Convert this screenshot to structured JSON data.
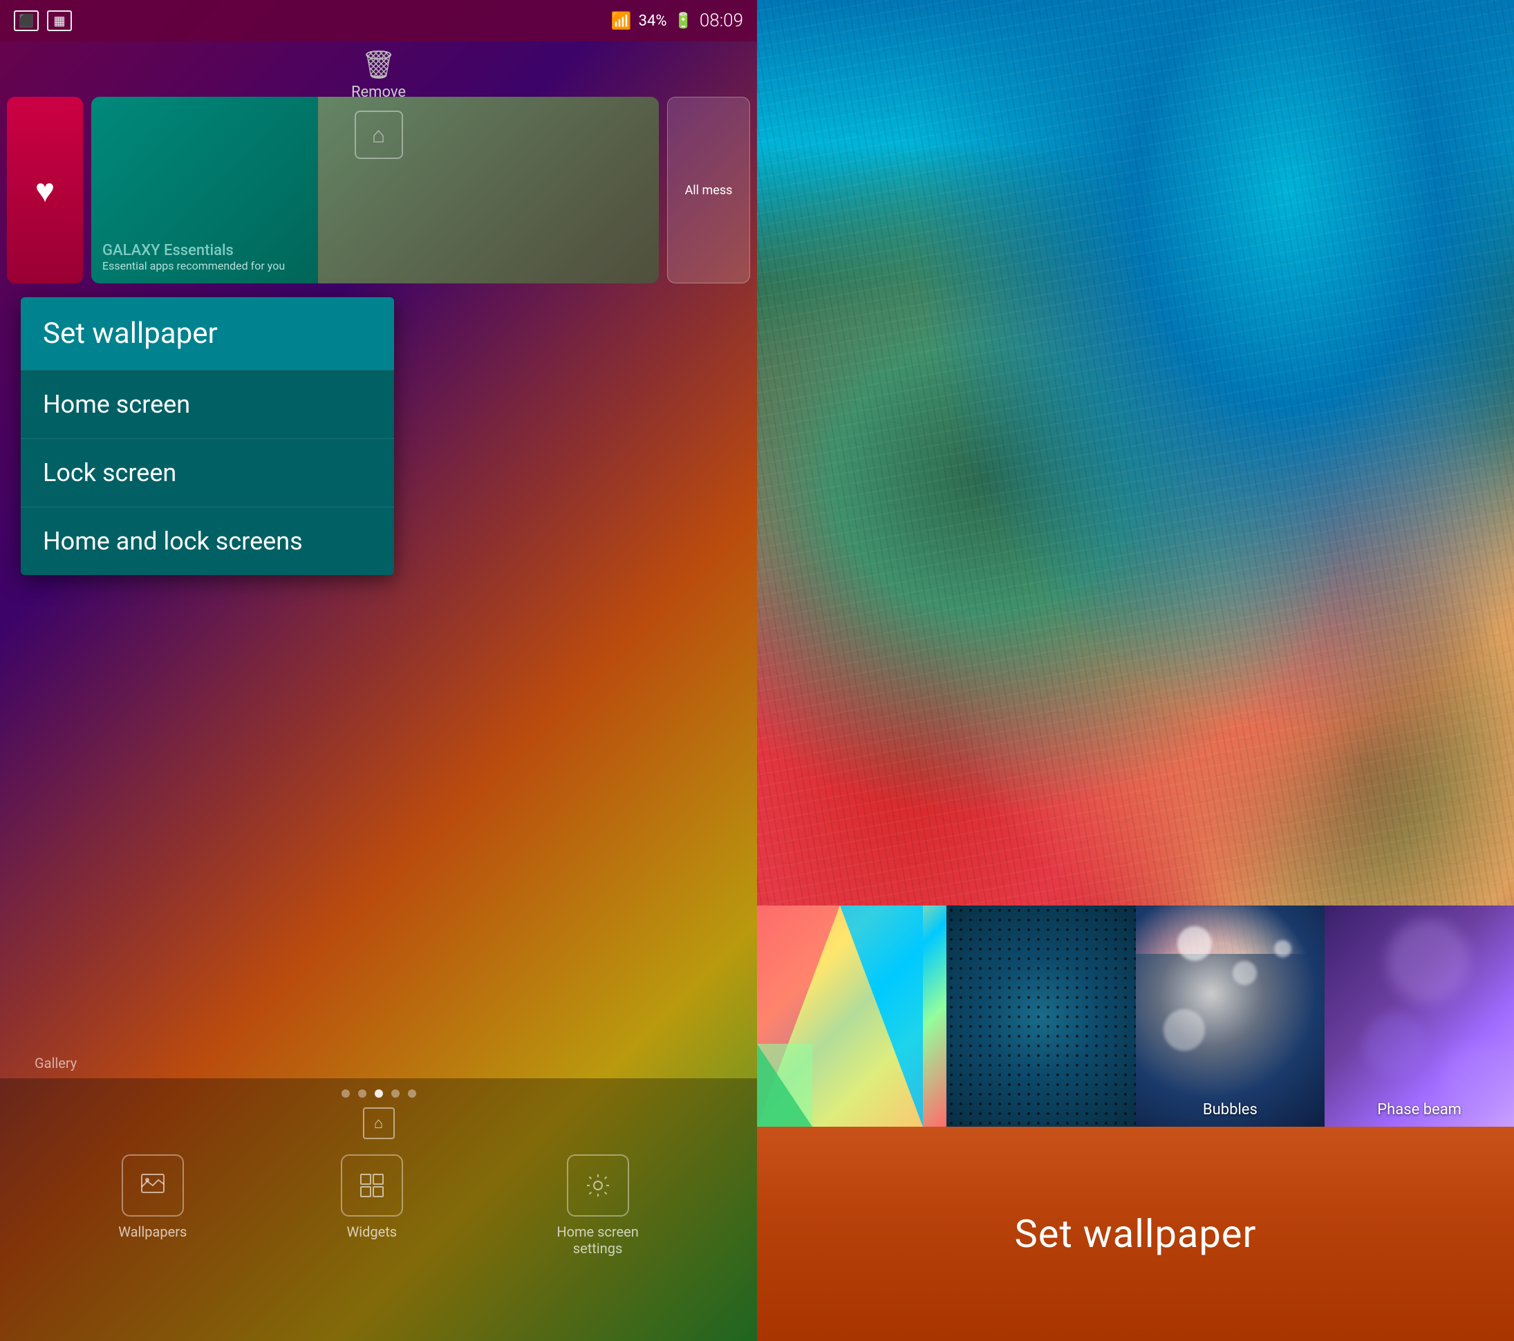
{
  "left": {
    "status_bar": {
      "signal": "▲▲▲",
      "battery": "34%",
      "time": "08:09",
      "icon1": "📷",
      "icon2": "📊"
    },
    "remove_label": "Remove",
    "galaxy_essentials": {
      "title": "GALAXY Essentials",
      "subtitle": "Essential apps recommended for you"
    },
    "msg_label": "All mess",
    "context_menu": {
      "header": "Set wallpaper",
      "item1": "Home screen",
      "item2": "Lock screen",
      "item3": "Home and lock screens"
    },
    "dock": {
      "items": [
        {
          "label": "Wallpapers",
          "icon": "🖼"
        },
        {
          "label": "Widgets",
          "icon": "▦"
        },
        {
          "label": "Home screen\nsettings",
          "icon": "⚙"
        }
      ]
    }
  },
  "right": {
    "thumbnails": [
      {
        "label": ""
      },
      {
        "label": ""
      },
      {
        "label": "Bubbles"
      },
      {
        "label": "Phase beam"
      }
    ],
    "set_wallpaper_label": "Set wallpaper"
  }
}
